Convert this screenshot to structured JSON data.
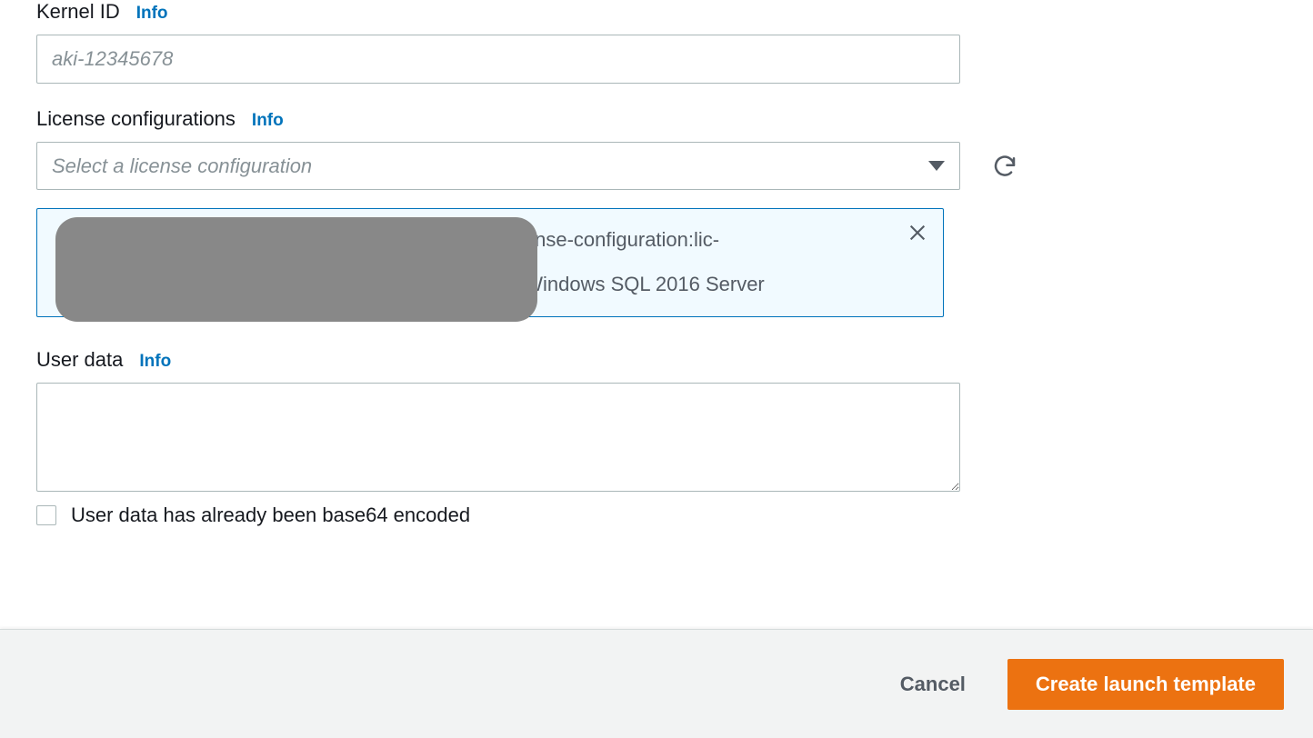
{
  "labels": {
    "kernel_id": "Kernel ID",
    "license_config": "License configurations",
    "user_data": "User data",
    "info": "Info"
  },
  "kernel": {
    "placeholder": "aki-12345678"
  },
  "license": {
    "placeholder": "Select a license configuration",
    "selected_line1": ":license-configuration:lic-",
    "selected_line2": ": Windows SQL 2016 Server"
  },
  "userdata": {
    "checkbox_label": "User data has already been base64 encoded"
  },
  "footer": {
    "cancel": "Cancel",
    "create": "Create launch template"
  }
}
